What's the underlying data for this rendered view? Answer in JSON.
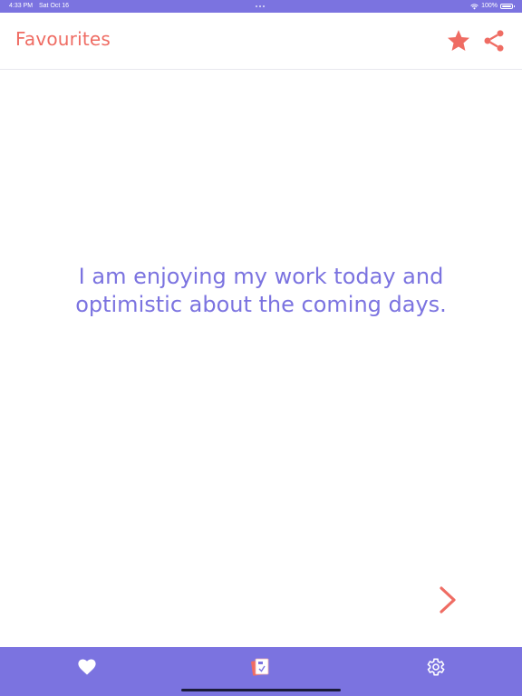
{
  "status_bar": {
    "time": "4:33 PM",
    "date": "Sat Oct 16",
    "battery": "100%"
  },
  "header": {
    "title": "Favourites",
    "star_icon": "star-icon",
    "share_icon": "share-icon"
  },
  "content": {
    "affirmation": "I am enjoying my work today and optimistic about the coming days.",
    "next_icon": "chevron-right-icon"
  },
  "tab_bar": {
    "tabs": [
      {
        "icon": "heart-icon"
      },
      {
        "icon": "app-logo-icon"
      },
      {
        "icon": "gear-icon"
      }
    ]
  },
  "colors": {
    "accent": "#ef6c63",
    "primary": "#7b73e0",
    "background": "#ffffff"
  }
}
